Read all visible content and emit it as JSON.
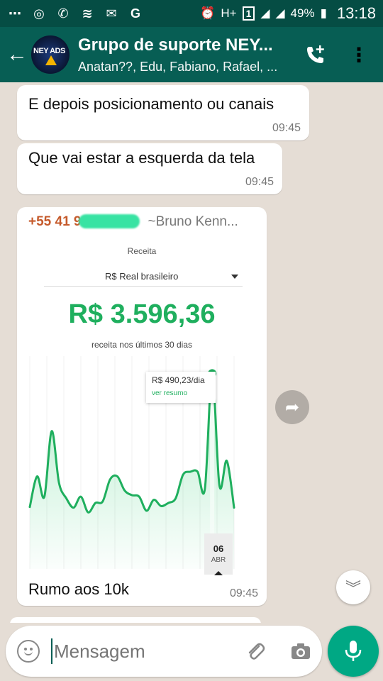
{
  "status_bar": {
    "battery": "49%",
    "time": "13:18",
    "network_type": "H+",
    "sim": "1"
  },
  "header": {
    "title": "Grupo de suporte NEY...",
    "subtitle": "Anatan??, Edu, Fabiano, Rafael, ...",
    "avatar_text": "NEY ADS"
  },
  "messages": [
    {
      "text": "E depois posicionamento ou canais",
      "time": "09:45"
    },
    {
      "text": "Que vai estar a esquerda da tela",
      "time": "09:45"
    }
  ],
  "image_message": {
    "sender_phone": "+55 41 9",
    "sender_alias": "~Bruno Kenn...",
    "caption": "Rumo aos 10k",
    "time": "09:45",
    "screenshot": {
      "title": "Receita",
      "currency_select": "R$ Real brasileiro",
      "amount": "R$ 3.596,36",
      "amount_caption": "receita nos últimos 30 dias",
      "tooltip_value": "R$ 490,23/dia",
      "tooltip_link": "ver resumo",
      "selected_day": "06",
      "selected_month": "ABR"
    }
  },
  "chart_data": {
    "type": "area",
    "title": "",
    "xlabel": "",
    "ylabel": "",
    "color": "#1faf5e",
    "ylim": [
      0,
      500
    ],
    "values": [
      62,
      160,
      95,
      305,
      140,
      90,
      60,
      95,
      45,
      75,
      80,
      150,
      160,
      115,
      100,
      95,
      50,
      85,
      65,
      75,
      90,
      165,
      175,
      175,
      120,
      490,
      130,
      210,
      60
    ],
    "highlight_index": 25,
    "highlight_value": 490.23
  },
  "input": {
    "placeholder": "Mensagem"
  },
  "colors": {
    "header": "#075e54",
    "status_bar": "#054d44",
    "accent_green": "#00a884",
    "revenue_green": "#1faf5e",
    "sender_phone": "#c55a2b"
  }
}
